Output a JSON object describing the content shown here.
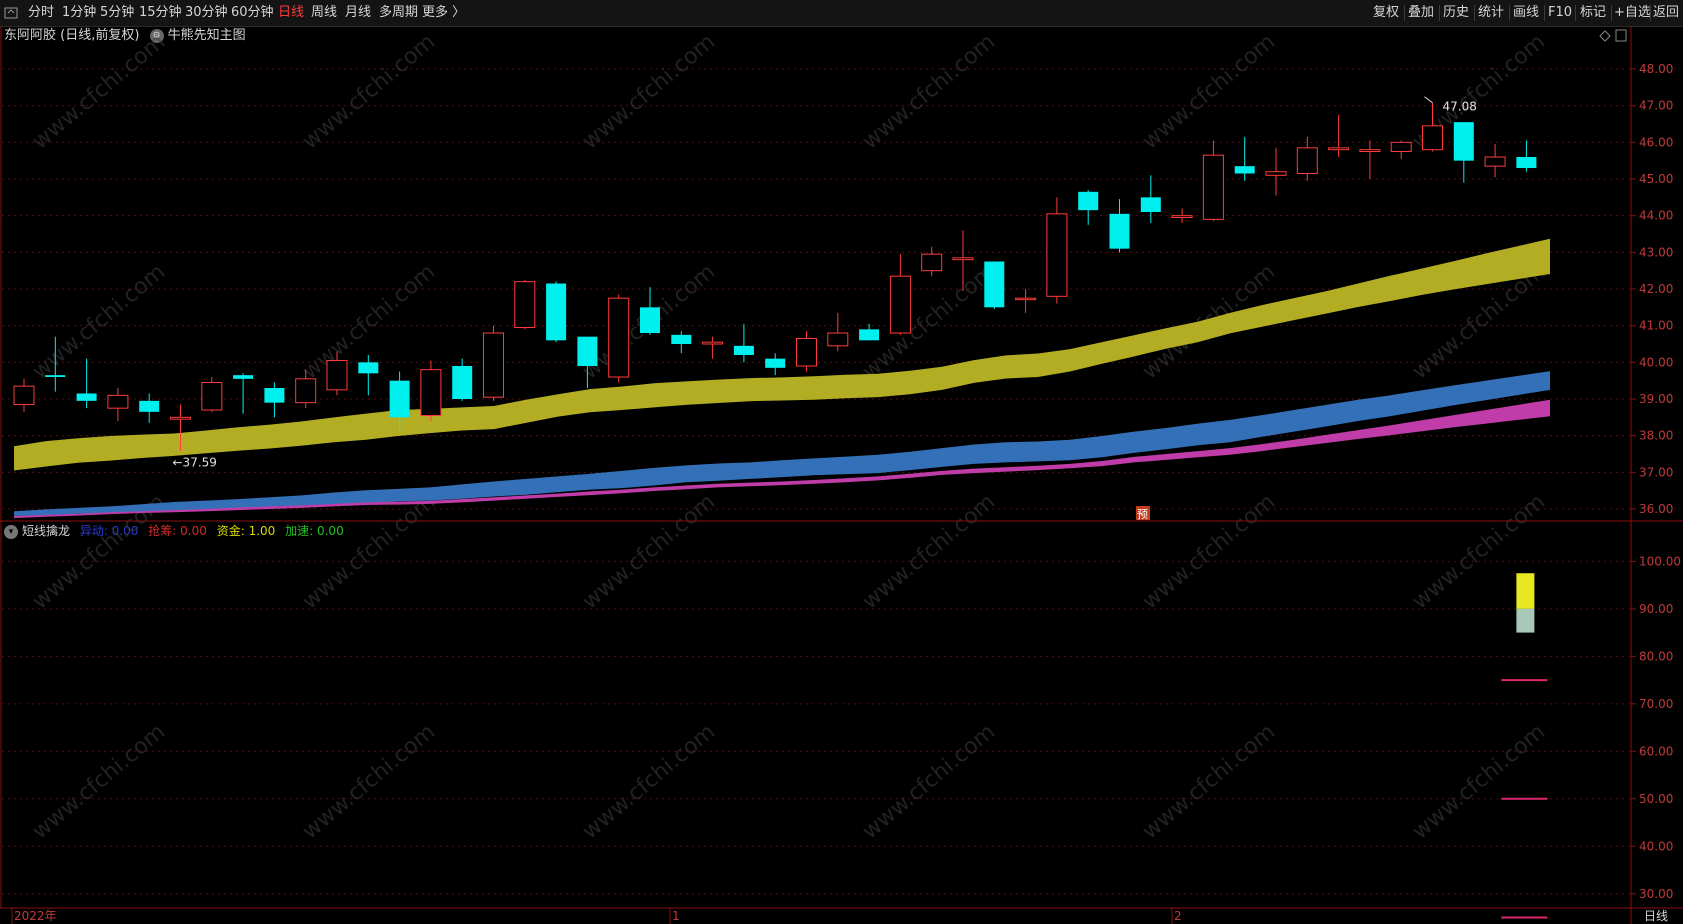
{
  "toolbar": {
    "menu_icon": "menu-icon",
    "periods": [
      "分时",
      "1分钟",
      "5分钟",
      "15分钟",
      "30分钟",
      "60分钟",
      "日线",
      "周线",
      "月线",
      "多周期",
      "更多 〉"
    ],
    "active_period": "日线",
    "right_buttons": [
      "复权",
      "叠加",
      "历史",
      "统计",
      "画线",
      "F10",
      "+自选",
      "返回"
    ],
    "mark_label": "标记"
  },
  "main_chart": {
    "title": "东阿阿胶 (日线,前复权)",
    "indicator_name": "牛熊先知主图",
    "y_ticks": [
      "48.00",
      "47.00",
      "46.00",
      "45.00",
      "44.00",
      "43.00",
      "42.00",
      "41.00",
      "40.00",
      "39.00",
      "38.00",
      "37.00",
      "36.00"
    ],
    "high_label": "47.08",
    "low_label": "←37.59",
    "marker_label": "预"
  },
  "sub_chart": {
    "name": "短线擒龙",
    "readouts": [
      {
        "label": "异动:",
        "value": "0.00",
        "color": "#2a3bd6"
      },
      {
        "label": "抢筹:",
        "value": "0.00",
        "color": "#d42a2a"
      },
      {
        "label": "资金:",
        "value": "1.00",
        "color": "#d8d800"
      },
      {
        "label": "加速:",
        "value": "0.00",
        "color": "#22c022"
      }
    ],
    "y_ticks": [
      "100.00",
      "90.00",
      "80.00",
      "70.00",
      "60.00",
      "50.00",
      "40.00",
      "30.00"
    ]
  },
  "x_axis": {
    "labels": [
      "2022年",
      "1",
      "2"
    ],
    "period_tag": "日线"
  },
  "watermark": "www.cfchi.com",
  "colors": {
    "up": "#ff3b3b",
    "down": "#00f0f0",
    "band_yellow": "#b3ad24",
    "band_blue": "#3470b8",
    "band_magenta": "#c03ca8",
    "grid": "#5a0d0d",
    "axis": "#8a1010"
  },
  "chart_data": [
    {
      "type": "candlestick",
      "title": "东阿阿胶 (日线,前复权)",
      "ylim": [
        35.7,
        48.6
      ],
      "candles": [
        {
          "o": 38.85,
          "h": 39.55,
          "l": 38.65,
          "c": 39.35
        },
        {
          "o": 39.65,
          "h": 40.7,
          "l": 39.2,
          "c": 39.6
        },
        {
          "o": 39.15,
          "h": 40.1,
          "l": 38.75,
          "c": 38.95
        },
        {
          "o": 38.75,
          "h": 39.3,
          "l": 38.4,
          "c": 39.1
        },
        {
          "o": 38.95,
          "h": 39.15,
          "l": 38.35,
          "c": 38.65
        },
        {
          "o": 38.45,
          "h": 38.85,
          "l": 37.59,
          "c": 38.5
        },
        {
          "o": 38.7,
          "h": 39.6,
          "l": 38.65,
          "c": 39.45
        },
        {
          "o": 39.65,
          "h": 39.7,
          "l": 38.6,
          "c": 39.55
        },
        {
          "o": 39.3,
          "h": 39.45,
          "l": 38.5,
          "c": 38.9
        },
        {
          "o": 38.9,
          "h": 39.8,
          "l": 38.75,
          "c": 39.55
        },
        {
          "o": 39.25,
          "h": 40.3,
          "l": 39.1,
          "c": 40.05
        },
        {
          "o": 40.0,
          "h": 40.2,
          "l": 39.1,
          "c": 39.7
        },
        {
          "o": 39.5,
          "h": 39.75,
          "l": 38.1,
          "c": 38.5
        },
        {
          "o": 38.55,
          "h": 40.05,
          "l": 38.4,
          "c": 39.8
        },
        {
          "o": 39.9,
          "h": 40.1,
          "l": 38.95,
          "c": 39.0
        },
        {
          "o": 39.05,
          "h": 41.0,
          "l": 38.95,
          "c": 40.8
        },
        {
          "o": 40.95,
          "h": 42.25,
          "l": 40.9,
          "c": 42.2
        },
        {
          "o": 42.15,
          "h": 42.2,
          "l": 40.55,
          "c": 40.6
        },
        {
          "o": 40.7,
          "h": 40.7,
          "l": 39.3,
          "c": 39.9
        },
        {
          "o": 39.6,
          "h": 41.85,
          "l": 39.45,
          "c": 41.75
        },
        {
          "o": 41.5,
          "h": 42.05,
          "l": 40.75,
          "c": 40.8
        },
        {
          "o": 40.75,
          "h": 40.85,
          "l": 40.25,
          "c": 40.5
        },
        {
          "o": 40.5,
          "h": 40.7,
          "l": 40.1,
          "c": 40.55
        },
        {
          "o": 40.45,
          "h": 41.05,
          "l": 40.0,
          "c": 40.2
        },
        {
          "o": 40.1,
          "h": 40.25,
          "l": 39.65,
          "c": 39.85
        },
        {
          "o": 39.9,
          "h": 40.85,
          "l": 39.75,
          "c": 40.65
        },
        {
          "o": 40.45,
          "h": 41.35,
          "l": 40.3,
          "c": 40.8
        },
        {
          "o": 40.9,
          "h": 41.05,
          "l": 40.6,
          "c": 40.6
        },
        {
          "o": 40.8,
          "h": 42.95,
          "l": 40.75,
          "c": 42.35
        },
        {
          "o": 42.5,
          "h": 43.15,
          "l": 42.35,
          "c": 42.95
        },
        {
          "o": 42.8,
          "h": 43.6,
          "l": 41.95,
          "c": 42.85
        },
        {
          "o": 42.75,
          "h": 42.75,
          "l": 41.45,
          "c": 41.5
        },
        {
          "o": 41.75,
          "h": 42.0,
          "l": 41.35,
          "c": 41.75
        },
        {
          "o": 41.8,
          "h": 44.5,
          "l": 41.6,
          "c": 44.05
        },
        {
          "o": 44.65,
          "h": 44.7,
          "l": 43.75,
          "c": 44.15
        },
        {
          "o": 44.05,
          "h": 44.45,
          "l": 43.0,
          "c": 43.1
        },
        {
          "o": 44.5,
          "h": 45.1,
          "l": 43.8,
          "c": 44.1
        },
        {
          "o": 43.95,
          "h": 44.2,
          "l": 43.8,
          "c": 44.0
        },
        {
          "o": 43.9,
          "h": 46.05,
          "l": 43.85,
          "c": 45.65
        },
        {
          "o": 45.35,
          "h": 46.15,
          "l": 44.95,
          "c": 45.15
        },
        {
          "o": 45.1,
          "h": 45.85,
          "l": 44.55,
          "c": 45.2
        },
        {
          "o": 45.15,
          "h": 46.15,
          "l": 44.95,
          "c": 45.85
        },
        {
          "o": 45.8,
          "h": 46.75,
          "l": 45.6,
          "c": 45.85
        },
        {
          "o": 45.75,
          "h": 46.05,
          "l": 45.0,
          "c": 45.8
        },
        {
          "o": 45.75,
          "h": 46.05,
          "l": 45.55,
          "c": 46.0
        },
        {
          "o": 45.8,
          "h": 47.08,
          "l": 45.75,
          "c": 46.45
        },
        {
          "o": 46.55,
          "h": 46.55,
          "l": 44.9,
          "c": 45.5
        },
        {
          "o": 45.35,
          "h": 45.95,
          "l": 45.05,
          "c": 45.6
        },
        {
          "o": 45.6,
          "h": 46.05,
          "l": 45.2,
          "c": 45.3
        }
      ],
      "bands": [
        {
          "name": "",
          "color": "#b3ad24",
          "lower": [
            37.05,
            37.16,
            37.26,
            37.32,
            37.39,
            37.45,
            37.52,
            37.59,
            37.65,
            37.73,
            37.82,
            37.89,
            37.99,
            38.07,
            38.14,
            38.18,
            38.35,
            38.52,
            38.64,
            38.7,
            38.77,
            38.84,
            38.89,
            38.94,
            38.96,
            38.98,
            39.02,
            39.05,
            39.13,
            39.25,
            39.44,
            39.56,
            39.6,
            39.75,
            39.96,
            40.16,
            40.37,
            40.55,
            40.79,
            40.97,
            41.15,
            41.33,
            41.51,
            41.67,
            41.84,
            41.99,
            42.13,
            42.27,
            42.41
          ],
          "upper": [
            37.71,
            37.85,
            37.93,
            37.99,
            38.03,
            38.06,
            38.14,
            38.23,
            38.3,
            38.39,
            38.5,
            38.6,
            38.7,
            38.73,
            38.77,
            38.81,
            38.98,
            39.13,
            39.27,
            39.34,
            39.43,
            39.48,
            39.53,
            39.57,
            39.59,
            39.62,
            39.66,
            39.69,
            39.77,
            39.88,
            40.06,
            40.19,
            40.24,
            40.36,
            40.55,
            40.74,
            40.93,
            41.11,
            41.35,
            41.56,
            41.75,
            41.94,
            42.15,
            42.36,
            42.56,
            42.76,
            42.97,
            43.17,
            43.37
          ]
        },
        {
          "name": "",
          "color": "#3470b8",
          "lower": [
            35.81,
            35.83,
            35.87,
            35.89,
            35.92,
            35.93,
            35.97,
            36.01,
            36.03,
            36.05,
            36.11,
            36.15,
            36.21,
            36.23,
            36.28,
            36.34,
            36.39,
            36.46,
            36.53,
            36.57,
            36.64,
            36.73,
            36.77,
            36.82,
            36.87,
            36.92,
            36.95,
            36.98,
            37.06,
            37.15,
            37.23,
            37.27,
            37.3,
            37.33,
            37.41,
            37.53,
            37.63,
            37.74,
            37.82,
            37.97,
            38.11,
            38.25,
            38.4,
            38.53,
            38.68,
            38.83,
            38.97,
            39.11,
            39.25
          ],
          "upper": [
            35.94,
            35.99,
            36.03,
            36.07,
            36.13,
            36.19,
            36.23,
            36.27,
            36.32,
            36.37,
            36.45,
            36.51,
            36.55,
            36.59,
            36.67,
            36.75,
            36.82,
            36.89,
            36.96,
            37.04,
            37.12,
            37.19,
            37.24,
            37.27,
            37.33,
            37.38,
            37.43,
            37.48,
            37.56,
            37.66,
            37.76,
            37.82,
            37.84,
            37.89,
            37.99,
            38.11,
            38.21,
            38.33,
            38.43,
            38.56,
            38.7,
            38.84,
            38.98,
            39.1,
            39.24,
            39.37,
            39.5,
            39.63,
            39.76
          ]
        },
        {
          "name": "",
          "color": "#c03ca8",
          "lower": [
            35.75,
            35.79,
            35.82,
            35.86,
            35.89,
            35.91,
            35.94,
            35.97,
            36.0,
            36.03,
            36.07,
            36.11,
            36.12,
            36.14,
            36.18,
            36.23,
            36.28,
            36.33,
            36.38,
            36.43,
            36.49,
            36.54,
            36.59,
            36.62,
            36.65,
            36.69,
            36.73,
            36.78,
            36.85,
            36.93,
            36.98,
            37.02,
            37.06,
            37.11,
            37.17,
            37.27,
            37.34,
            37.41,
            37.48,
            37.58,
            37.69,
            37.8,
            37.91,
            38.01,
            38.12,
            38.23,
            38.33,
            38.43,
            38.53
          ],
          "upper": [
            35.81,
            35.84,
            35.87,
            35.91,
            35.94,
            35.97,
            36.0,
            36.04,
            36.07,
            36.1,
            36.14,
            36.18,
            36.2,
            36.22,
            36.27,
            36.32,
            36.37,
            36.42,
            36.48,
            36.53,
            36.59,
            36.64,
            36.69,
            36.72,
            36.75,
            36.79,
            36.84,
            36.89,
            36.96,
            37.04,
            37.1,
            37.14,
            37.18,
            37.23,
            37.31,
            37.42,
            37.5,
            37.58,
            37.66,
            37.77,
            37.89,
            38.02,
            38.15,
            38.28,
            38.42,
            38.56,
            38.7,
            38.84,
            38.98
          ]
        }
      ]
    },
    {
      "type": "bar",
      "title": "短线擒龙",
      "ylim": [
        27.0,
        104.5
      ],
      "series": [
        {
          "name": "资金",
          "color": "#e8e820",
          "values": [
            1.0
          ]
        }
      ],
      "stack_top": 97.5,
      "stack_mid": 90.0,
      "stack_bottom": 85.0,
      "reference_levels": [
        75.0,
        50.0,
        25.0
      ]
    }
  ]
}
